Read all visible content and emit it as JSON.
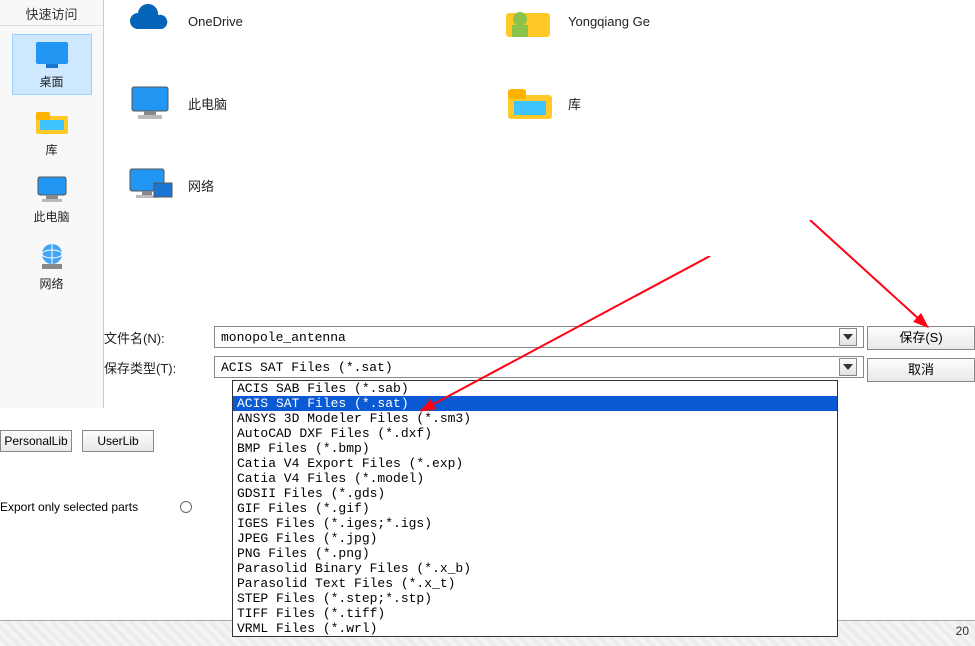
{
  "sidebar": {
    "header": "快速访问",
    "items": [
      {
        "label": "桌面",
        "icon": "desktop"
      },
      {
        "label": "库",
        "icon": "library"
      },
      {
        "label": "此电脑",
        "icon": "pc"
      },
      {
        "label": "网络",
        "icon": "network"
      }
    ]
  },
  "files": {
    "items": [
      {
        "label": "OneDrive",
        "icon": "cloud"
      },
      {
        "label": "Yongqiang Ge",
        "icon": "user"
      },
      {
        "label": "此电脑",
        "icon": "pc"
      },
      {
        "label": "库",
        "icon": "library"
      },
      {
        "label": "网络",
        "icon": "network"
      }
    ]
  },
  "form": {
    "filename_label": "文件名(N):",
    "filename_value": "monopole_antenna",
    "filetype_label": "保存类型(T):",
    "filetype_value": "ACIS SAT Files (*.sat)"
  },
  "buttons": {
    "save": "保存(S)",
    "cancel": "取消",
    "personal_lib": "PersonalLib",
    "user_lib": "UserLib"
  },
  "export": {
    "label": "Export only selected parts"
  },
  "filetype_options": [
    "ACIS SAB Files (*.sab)",
    "ACIS SAT Files (*.sat)",
    "ANSYS 3D Modeler Files (*.sm3)",
    "AutoCAD DXF Files (*.dxf)",
    "BMP Files (*.bmp)",
    "Catia V4 Export Files (*.exp)",
    "Catia V4 Files (*.model)",
    "GDSII Files (*.gds)",
    "GIF Files (*.gif)",
    "IGES Files (*.iges;*.igs)",
    "JPEG Files (*.jpg)",
    "PNG Files (*.png)",
    "Parasolid Binary Files (*.x_b)",
    "Parasolid Text Files (*.x_t)",
    "STEP Files (*.step;*.stp)",
    "TIFF Files (*.tiff)",
    "VRML Files (*.wrl)"
  ],
  "filetype_selected_index": 1,
  "status": {
    "zoom": "20"
  }
}
